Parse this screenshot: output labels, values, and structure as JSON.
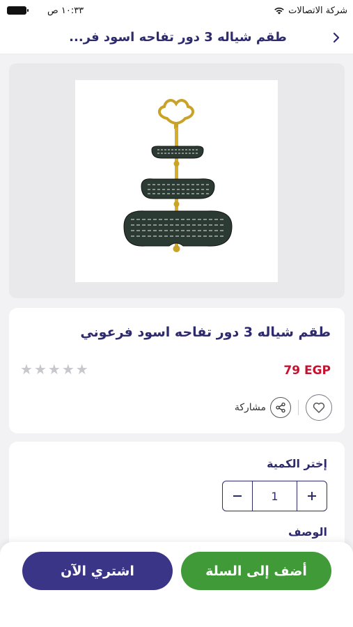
{
  "status": {
    "carrier": "شركة الاتصالات",
    "time": "١٠:٣٣ ص"
  },
  "header": {
    "title": "طقم شياله 3 دور تفاحه اسود فر..."
  },
  "product": {
    "name": "طقم شياله 3 دور تفاحه اسود فرعوني",
    "price": "79 EGP",
    "rating": 0,
    "rating_max": 5,
    "share_label": "مشاركة"
  },
  "quantity": {
    "title": "إختر الكمية",
    "value": "1"
  },
  "description": {
    "title": "الوصف"
  },
  "actions": {
    "add_to_cart": "أضف إلى السلة",
    "buy_now": "اشتري الآن"
  },
  "colors": {
    "brand": "#2e2a6e",
    "buy_button": "#3a3587",
    "cart_button": "#3f9a37",
    "price": "#c41230"
  }
}
